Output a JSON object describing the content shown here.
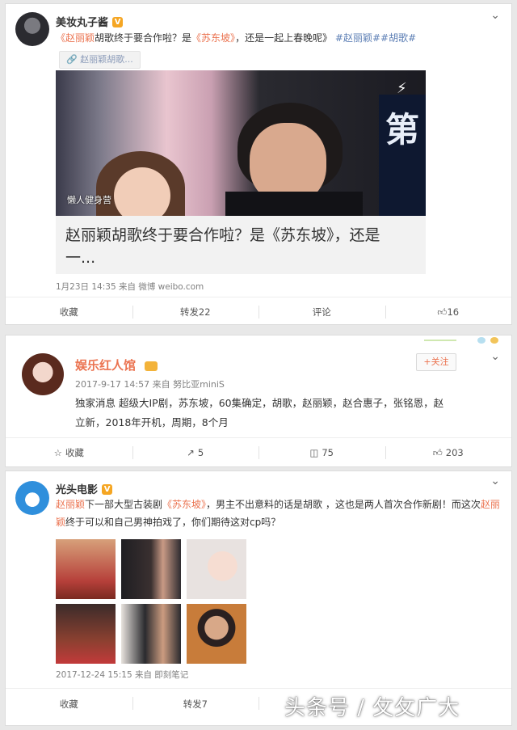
{
  "post1": {
    "author": "美妆丸子酱",
    "verified": "V",
    "text_prefix": "《",
    "mention1": "赵丽颖",
    "text_mid1": "胡歌终于要合作啦？是",
    "mention2": "《苏东坡》",
    "text_mid2": "，还是一起上春晚呢》",
    "tag1": "#赵丽颖#",
    "tag2": "#胡歌#",
    "topic_chip": "赵丽颖胡歌...",
    "image_watermark": "懒人健身营",
    "image_side_char": "第",
    "article_title_line1": "赵丽颖胡歌终于要合作啦？是《苏东坡》，还是",
    "article_title_line2": "一...",
    "meta": "1月23日 14:35 来自 微博 weibo.com",
    "actions": {
      "collect": "收藏",
      "repost": "转发22",
      "comment": "评论",
      "like": "16"
    }
  },
  "post2": {
    "author": "娱乐红人馆",
    "follow_label": "+关注",
    "meta": "2017-9-17 14:57 来自 努比亚miniS",
    "text_line1": "独家消息 超级大IP剧，苏东坡，60集确定，胡歌，赵丽颖，赵合惠子，张铭恩，赵",
    "text_line2": "立新，2018年开机，周期，8个月",
    "actions": {
      "collect": "收藏",
      "repost": "5",
      "comment": "75",
      "like": "203"
    }
  },
  "post3": {
    "author": "光头电影",
    "verified": "V",
    "mention1": "赵丽颖",
    "text_a": "下一部大型古装剧",
    "mention2": "《苏东坡》",
    "text_b": "，男主不出意料的话是胡歌 ，这也是两人首次合作新剧！而这",
    "text_c": "次",
    "mention3": "赵丽颖",
    "text_d": "终于可以和自己男神拍戏了，你们期待这对cp吗？",
    "meta": "2017-12-24 15:15 来自 即刻笔记",
    "actions": {
      "collect": "收藏",
      "repost": "转发7"
    }
  },
  "watermark": "头条号 / 攵攵广大",
  "colors": {
    "accent": "#eb7350",
    "tag": "#5d7fb5",
    "verified": "#f5a623"
  }
}
